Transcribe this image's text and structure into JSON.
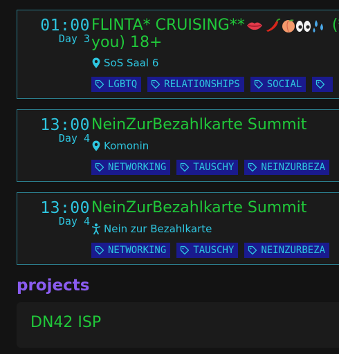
{
  "events": [
    {
      "time": "01:00",
      "day": "Day 3",
      "title_line1": "FLINTA* CRUISING**",
      "title_after_emoji": "(*",
      "title_line2": "you) 18+",
      "meta_icon": "location-pin-icon",
      "meta": "SoS Saal 6",
      "tags": [
        "LGBTQ",
        "RELATIONSHIPS",
        "SOCIAL",
        ""
      ]
    },
    {
      "time": "13:00",
      "day": "Day 4",
      "title": "NeinZurBezahlkarte Summit",
      "meta_icon": "location-pin-icon",
      "meta": "Komonin",
      "tags": [
        "NETWORKING",
        "TAUSCHY",
        "NEINZURBEZA"
      ]
    },
    {
      "time": "13:00",
      "day": "Day 4",
      "title": "NeinZurBezahlkarte Summit",
      "meta_icon": "person-icon",
      "meta": "Nein zur Bezahlkarte",
      "tags": [
        "NETWORKING",
        "TAUSCHY",
        "NEINZURBEZA"
      ]
    }
  ],
  "projects": {
    "heading": "projects",
    "items": [
      {
        "name": "DN42 ISP"
      }
    ]
  },
  "colors": {
    "accent_cyan": "#2ec6e0",
    "title_green": "#20c83a",
    "heading_purple": "#8a5cf0",
    "tag_bg": "#1a1a8e",
    "card_border": "#2b7d8c"
  }
}
